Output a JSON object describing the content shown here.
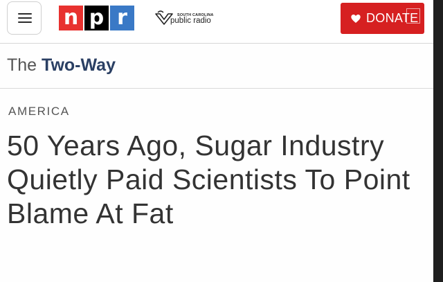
{
  "header": {
    "menu_icon": "hamburger-menu-icon",
    "logo_letters": [
      "n",
      "p",
      "r"
    ],
    "station_line1": "SOUTH CAROLINA",
    "station_line2": "public radio",
    "donate_label": "DONATE",
    "donate_icon": "heart-icon"
  },
  "blog": {
    "prefix": "The",
    "name": "Two-Way"
  },
  "article": {
    "section": "AMERICA",
    "headline": "50 Years Ago, Sugar Industry Quietly Paid Scientists To Point Blame At Fat"
  },
  "colors": {
    "npr_red": "#e8312f",
    "npr_black": "#000000",
    "npr_blue": "#3a79c6",
    "donate_red": "#d62021",
    "blog_name_navy": "#2a3f63"
  }
}
